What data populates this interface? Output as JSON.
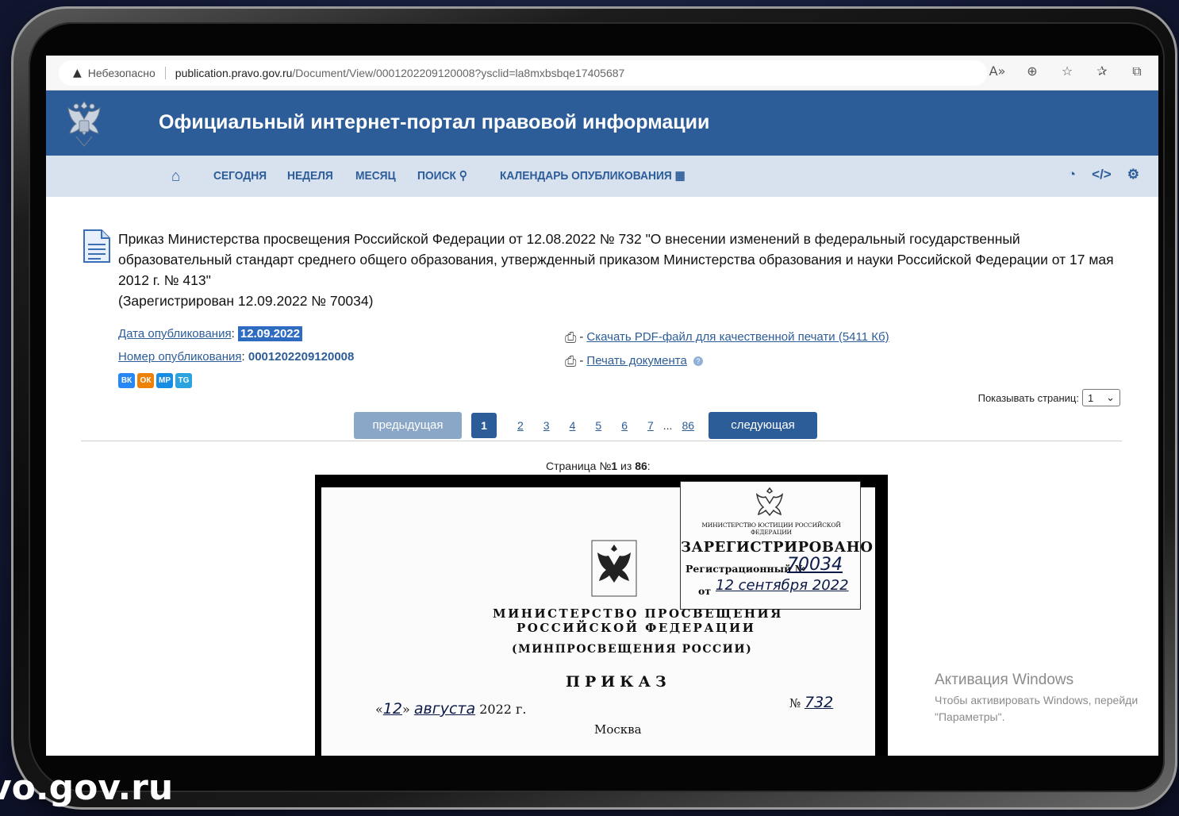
{
  "browser": {
    "security_label": "Небезопасно",
    "url_host": "publication.pravo.gov.ru",
    "url_path": "/Document/View/0001202209120008?ysclid=la8mxbsbqe17405687",
    "icons": [
      "read-aloud-icon",
      "zoom-icon",
      "favorite-add-icon",
      "favorites-icon",
      "collections-icon"
    ]
  },
  "header": {
    "title": "Официальный интернет-портал правовой информации",
    "emblem": "russian-coat-of-arms-icon"
  },
  "nav": {
    "home_icon": "home-icon",
    "items": [
      {
        "label": "СЕГОДНЯ"
      },
      {
        "label": "НЕДЕЛЯ"
      },
      {
        "label": "МЕСЯЦ"
      },
      {
        "label": "ПОИСК"
      },
      {
        "label": "КАЛЕНДАРЬ ОПУБЛИКОВАНИЯ"
      }
    ],
    "right_icons": [
      "rss-icon",
      "code-icon",
      "settings-cloud-icon"
    ],
    "colors": {
      "bar": "#d8e2ee",
      "text": "#2d5d99"
    }
  },
  "document": {
    "title": "Приказ Министерства просвещения Российской Федерации от 12.08.2022 № 732 \"О внесении изменений в федеральный государственный образовательный стандарт среднего общего образования, утвержденный приказом Министерства образования и науки Российской Федерации от 17 мая 2012 г. № 413\"",
    "registered": "(Зарегистрирован 12.09.2022 № 70034)",
    "pub_date_label": "Дата опубликования",
    "pub_date": "12.09.2022",
    "pub_number_label": "Номер опубликования",
    "pub_number": "0001202209120008",
    "socials": [
      "ВК",
      "ОК",
      "МР",
      "TG"
    ],
    "pdf_link": "Скачать PDF-файл для качественной печати (5411 Кб)",
    "print_link": "Печать документа",
    "dash": " - "
  },
  "pager": {
    "show_pages_label": "Показывать страниц:",
    "show_pages_value": "1",
    "prev_label": "предыдущая",
    "next_label": "следующая",
    "current": "1",
    "pages": [
      "2",
      "3",
      "4",
      "5",
      "6",
      "7"
    ],
    "ellipsis": "...",
    "last": "86"
  },
  "page_caption": {
    "prefix": "Страница №",
    "current": "1",
    "middle": " из ",
    "total": "86",
    "suffix": ":"
  },
  "scan": {
    "stamp_ministry": "МИНИСТЕРСТВО ЮСТИЦИИ РОССИЙСКОЙ ФЕДЕРАЦИИ",
    "stamp_registered": "ЗАРЕГИСТРИРОВАНО",
    "stamp_reg_label": "Регистрационный №",
    "stamp_reg_number": "70034",
    "stamp_from": "от",
    "stamp_date": "12 сентября 2022",
    "ministry_line1": "МИНИСТЕРСТВО ПРОСВЕЩЕНИЯ",
    "ministry_line2": "РОССИЙСКОЙ ФЕДЕРАЦИИ",
    "ministry_short": "(МИНПРОСВЕЩЕНИЯ РОССИИ)",
    "order_word": "ПРИКАЗ",
    "date_open": "«",
    "date_day": "12",
    "date_close": "»",
    "date_month": "августа",
    "date_year": "2022 г.",
    "number_sign": "№",
    "number_value": "732",
    "city": "Москва"
  },
  "watermark": {
    "title": "Активация Windows",
    "line1": "Чтобы активировать Windows, перейди",
    "line2": "\"Параметры\"."
  },
  "site_tag": "vo.gov.ru"
}
